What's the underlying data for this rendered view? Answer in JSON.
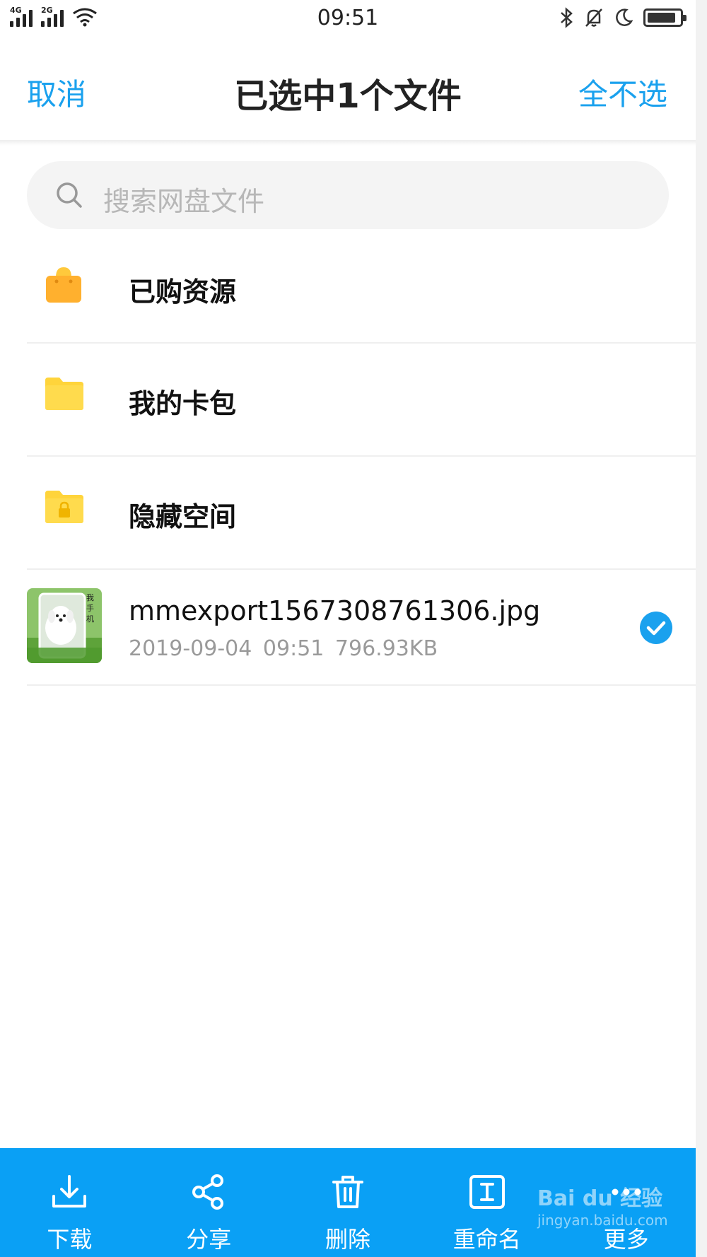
{
  "status_bar": {
    "sim1": "4G",
    "sim2": "2G",
    "time": "09:51"
  },
  "header": {
    "cancel_label": "取消",
    "title": "已选中1个文件",
    "select_none_label": "全不选"
  },
  "search": {
    "placeholder": "搜索网盘文件"
  },
  "items": [
    {
      "name": "已购资源",
      "icon": "shopping-bag-icon"
    },
    {
      "name": "我的卡包",
      "icon": "folder-icon"
    },
    {
      "name": "隐藏空间",
      "icon": "locked-folder-icon"
    },
    {
      "name": "mmexport1567308761306.jpg",
      "date": "2019-09-04",
      "time": "09:51",
      "size": "796.93KB",
      "thumb_caption": "我手机",
      "selected": true
    }
  ],
  "toolbar": {
    "download": "下载",
    "share": "分享",
    "delete": "删除",
    "rename": "重命名",
    "more": "更多"
  },
  "watermark": {
    "brand": "Bai du 经验",
    "url": "jingyan.baidu.com"
  },
  "colors": {
    "accent": "#1aa1ee",
    "toolbar": "#0aa0f5",
    "folder": "#ffd43b",
    "bag": "#ffb02e"
  }
}
